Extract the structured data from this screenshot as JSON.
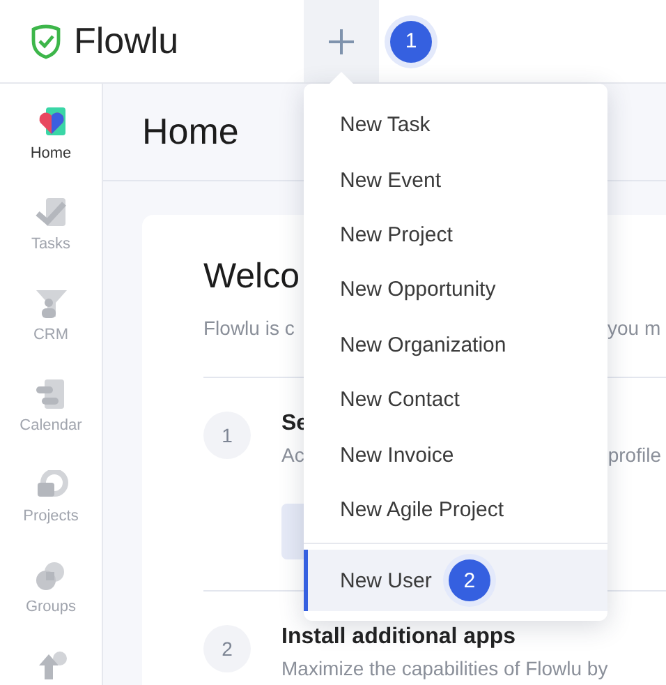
{
  "header": {
    "logo_text": "Flowlu",
    "add_menu_expanded": true,
    "step_badge": "1"
  },
  "sidebar": {
    "items": [
      {
        "label": "Home",
        "selected": true
      },
      {
        "label": "Tasks",
        "selected": false
      },
      {
        "label": "CRM",
        "selected": false
      },
      {
        "label": "Calendar",
        "selected": false
      },
      {
        "label": "Projects",
        "selected": false
      },
      {
        "label": "Groups",
        "selected": false
      }
    ]
  },
  "page_title": "Home",
  "welcome": {
    "title": "Welco",
    "subtitle_left": "Flowlu is c",
    "subtitle_right": "you m"
  },
  "steps": [
    {
      "number": "1",
      "title": "Se",
      "desc_left": "Ac",
      "desc_right": "profile",
      "has_button": true
    },
    {
      "number": "2",
      "title": "Install additional apps",
      "desc_left": "Maximize the capabilities of Flowlu by",
      "has_button": false
    }
  ],
  "menu": {
    "items": [
      {
        "label": "New Task",
        "selected": false
      },
      {
        "label": "New Event",
        "selected": false
      },
      {
        "label": "New Project",
        "selected": false
      },
      {
        "label": "New Opportunity",
        "selected": false
      },
      {
        "label": "New Organization",
        "selected": false
      },
      {
        "label": "New Contact",
        "selected": false
      },
      {
        "label": "New Invoice",
        "selected": false
      },
      {
        "label": "New Agile Project",
        "selected": false
      },
      {
        "label": "New User",
        "selected": true,
        "badge": "2",
        "separated": true
      }
    ]
  }
}
